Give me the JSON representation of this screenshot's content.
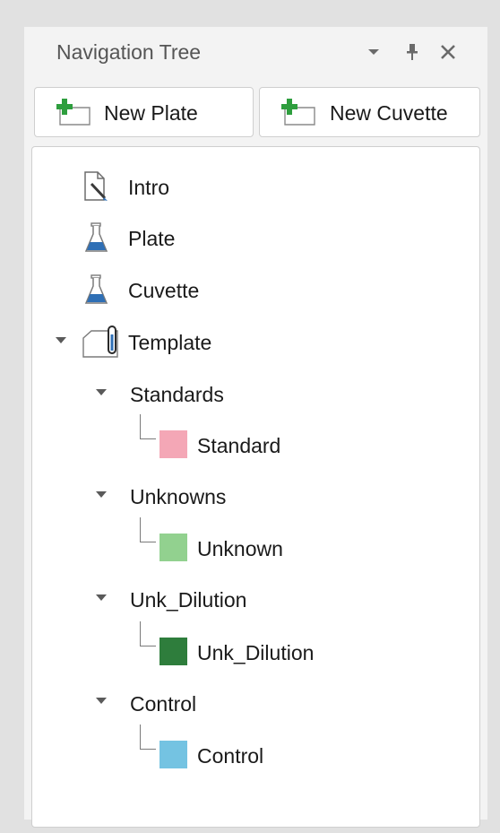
{
  "panel": {
    "title": "Navigation Tree",
    "controls": {
      "dropdown_icon": "triangle-down",
      "pin_icon": "pin",
      "close_icon": "x"
    }
  },
  "toolbar": {
    "new_plate_label": "New Plate",
    "new_cuvette_label": "New Cuvette",
    "button_icon": "green-plus-folder"
  },
  "tree": {
    "intro": {
      "label": "Intro",
      "icon": "document-pen-icon"
    },
    "plate": {
      "label": "Plate",
      "icon": "flask-icon"
    },
    "cuvette": {
      "label": "Cuvette",
      "icon": "flask-icon"
    },
    "template": {
      "label": "Template",
      "icon": "template-icon",
      "expanded": true,
      "groups": [
        {
          "label": "Standards",
          "expanded": true,
          "child": {
            "label": "Standard",
            "color": "#f4a7b6"
          }
        },
        {
          "label": "Unknowns",
          "expanded": true,
          "child": {
            "label": "Unknown",
            "color": "#92d18f"
          }
        },
        {
          "label": "Unk_Dilution",
          "expanded": true,
          "child": {
            "label": "Unk_Dilution",
            "color": "#2e7d3c"
          }
        },
        {
          "label": "Control",
          "expanded": true,
          "child": {
            "label": "Control",
            "color": "#74c3e2"
          }
        }
      ]
    }
  },
  "colors": {
    "panel_background": "#f3f3f3",
    "outer_background": "#e1e1e1",
    "flask_liquid": "#2f6fb5",
    "plus_green": "#2e9e3e"
  }
}
